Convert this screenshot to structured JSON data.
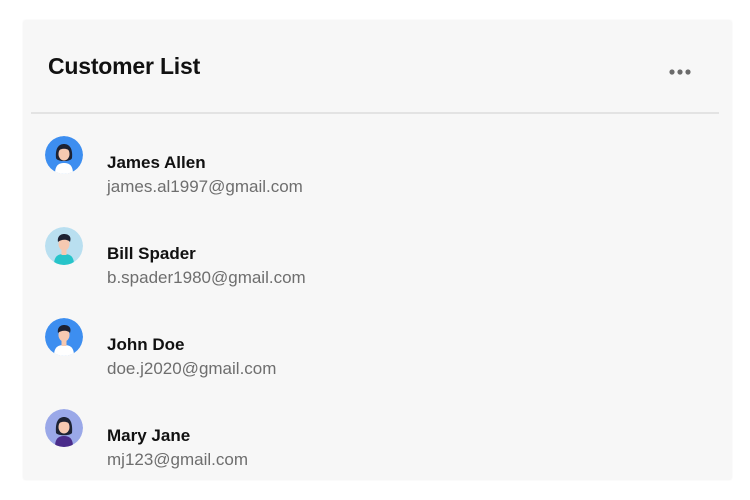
{
  "card": {
    "title": "Customer List",
    "menu_icon": "more-horizontal-icon"
  },
  "customers": [
    {
      "name": "James Allen",
      "email": "james.al1997@gmail.com",
      "avatar_bg": "#3d8ef0",
      "avatar_icon": "woman-avatar-icon"
    },
    {
      "name": "Bill Spader",
      "email": "b.spader1980@gmail.com",
      "avatar_bg": "#b9dff0",
      "avatar_icon": "man-avatar-icon"
    },
    {
      "name": "John Doe",
      "email": "doe.j2020@gmail.com",
      "avatar_bg": "#3d8ef0",
      "avatar_icon": "man-avatar-icon"
    },
    {
      "name": "Mary Jane",
      "email": "mj123@gmail.com",
      "avatar_bg": "#9aa8e8",
      "avatar_icon": "woman-avatar-icon"
    }
  ]
}
